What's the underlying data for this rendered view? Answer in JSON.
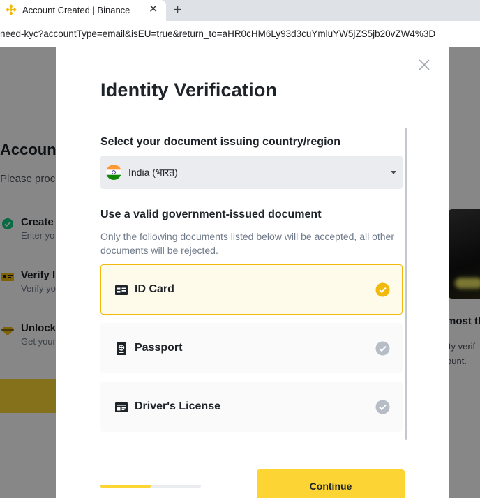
{
  "browser": {
    "tab_title": "Account Created | Binance",
    "tab_close": "✕",
    "new_tab": "+",
    "url": "need-kyc?accountType=email&isEU=true&return_to=aHR0cHM6Ly93d3cuYmluYW5jZS5jb20vZW4%3D"
  },
  "background": {
    "heading": "Accoun",
    "subtext": "Please proc",
    "steps": [
      {
        "title": "Create",
        "desc": "Enter yo",
        "icon": "check-circle-icon"
      },
      {
        "title": "Verify I",
        "desc": "Verify yo",
        "icon": "id-card-icon"
      },
      {
        "title": "Unlock",
        "desc": "Get your",
        "icon": "diamond-icon"
      }
    ],
    "right_title": "most th",
    "right_line1": "ity verif",
    "right_line2": "ount."
  },
  "modal": {
    "title": "Identity Verification",
    "country_label": "Select your document issuing country/region",
    "country_value": "India (भारत)",
    "document_label": "Use a valid government-issued document",
    "document_note": "Only the following documents listed below will be accepted, all other documents will be rejected.",
    "documents": [
      {
        "label": "ID Card",
        "icon": "id-card-icon",
        "selected": true
      },
      {
        "label": "Passport",
        "icon": "passport-icon",
        "selected": false
      },
      {
        "label": "Driver's License",
        "icon": "drivers-license-icon",
        "selected": false
      }
    ],
    "progress": 0.5,
    "continue_label": "Continue"
  },
  "colors": {
    "brand_yellow": "#fcd535",
    "selected_border": "#f0b90b",
    "check_selected": "#f0b90b",
    "check_unselected": "#b7bdc6"
  }
}
